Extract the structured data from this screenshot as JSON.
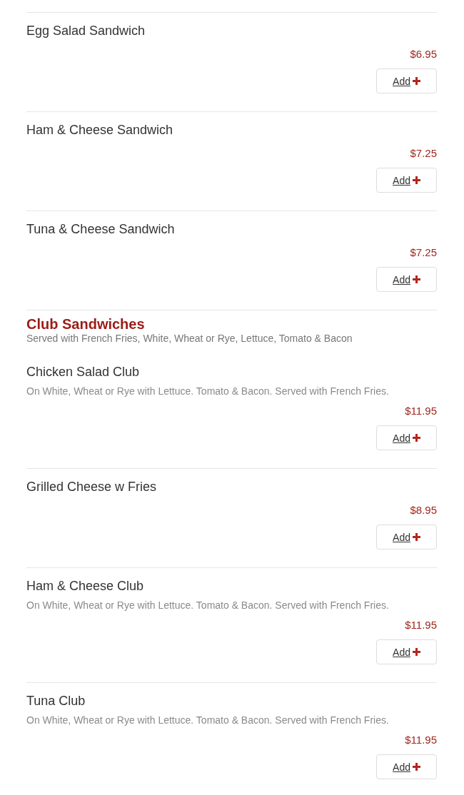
{
  "menu": [
    {
      "kind": "item",
      "name": "Egg Salad Sandwich",
      "price": "$6.95",
      "button": "Add"
    },
    {
      "kind": "item",
      "name": "Ham & Cheese Sandwich",
      "price": "$7.25",
      "button": "Add"
    },
    {
      "kind": "item",
      "name": "Tuna & Cheese Sandwich",
      "price": "$7.25",
      "button": "Add"
    },
    {
      "kind": "section",
      "title": "Club Sandwiches",
      "subtitle": "Served with French Fries, White, Wheat or Rye, Lettuce, Tomato & Bacon"
    },
    {
      "kind": "item",
      "name": "Chicken Salad Club",
      "description": "On White, Wheat or Rye with Lettuce. Tomato & Bacon. Served with French Fries.",
      "price": "$11.95",
      "button": "Add"
    },
    {
      "kind": "item",
      "name": "Grilled Cheese w Fries",
      "price": "$8.95",
      "button": "Add"
    },
    {
      "kind": "item",
      "name": "Ham & Cheese Club",
      "description": "On White, Wheat or Rye with Lettuce. Tomato & Bacon. Served with French Fries.",
      "price": "$11.95",
      "button": "Add"
    },
    {
      "kind": "item",
      "name": "Tuna Club",
      "description": "On White, Wheat or Rye with Lettuce. Tomato & Bacon. Served with French Fries.",
      "price": "$11.95",
      "button": "Add"
    }
  ]
}
